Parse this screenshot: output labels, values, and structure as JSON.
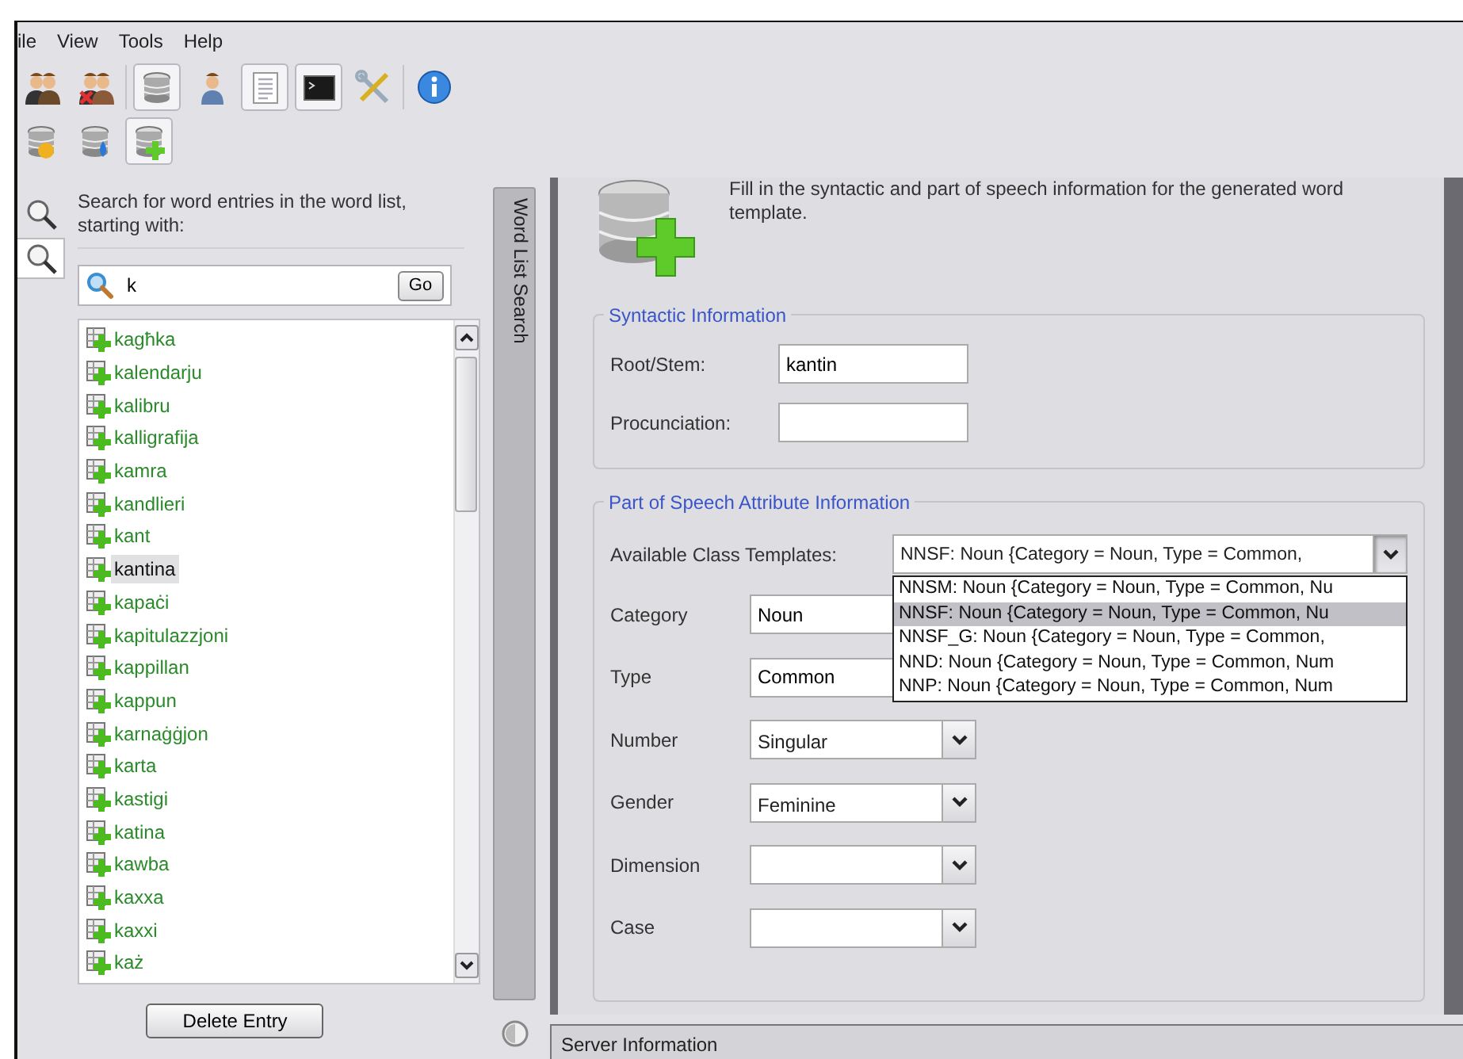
{
  "menu": [
    {
      "label": "ile"
    },
    {
      "label": "View"
    },
    {
      "label": "Tools"
    },
    {
      "label": "Help"
    }
  ],
  "toolbar_rows": [
    [
      {
        "kind": "people",
        "selected": false
      },
      {
        "kind": "people-remove",
        "selected": false
      },
      {
        "kind": "sep"
      },
      {
        "kind": "database",
        "selected": true
      },
      {
        "kind": "person",
        "selected": false
      },
      {
        "kind": "document",
        "selected": true
      },
      {
        "kind": "terminal",
        "selected": true
      },
      {
        "kind": "tools",
        "selected": false
      },
      {
        "kind": "sep"
      },
      {
        "kind": "info",
        "selected": false
      }
    ],
    [
      {
        "kind": "database-question",
        "selected": false
      },
      {
        "kind": "database-drop",
        "selected": false
      },
      {
        "kind": "database-add",
        "selected": true
      }
    ]
  ],
  "side_buttons": [
    {
      "selected": false
    },
    {
      "selected": true
    }
  ],
  "search_panel": {
    "description": "Search for word entries in the word list, starting with:",
    "query": "k",
    "go_button": "Go",
    "delete_button": "Delete Entry"
  },
  "word_list": [
    {
      "word": "kagħka",
      "selected": false
    },
    {
      "word": "kalendarju",
      "selected": false
    },
    {
      "word": "kalibru",
      "selected": false
    },
    {
      "word": "kalligrafija",
      "selected": false
    },
    {
      "word": "kamra",
      "selected": false
    },
    {
      "word": "kandlieri",
      "selected": false
    },
    {
      "word": "kant",
      "selected": false
    },
    {
      "word": "kantina",
      "selected": true
    },
    {
      "word": "kapaċi",
      "selected": false
    },
    {
      "word": "kapitulazzjoni",
      "selected": false
    },
    {
      "word": "kappillan",
      "selected": false
    },
    {
      "word": "kappun",
      "selected": false
    },
    {
      "word": "karnaġġjon",
      "selected": false
    },
    {
      "word": "karta",
      "selected": false
    },
    {
      "word": "kastigi",
      "selected": false
    },
    {
      "word": "katina",
      "selected": false
    },
    {
      "word": "kawba",
      "selected": false
    },
    {
      "word": "kaxxa",
      "selected": false
    },
    {
      "word": "kaxxi",
      "selected": false
    },
    {
      "word": "każ",
      "selected": false
    }
  ],
  "side_tab": "Word List Search",
  "intro": "Fill in the syntactic and part of speech information for the generated word template.",
  "syntactic": {
    "legend": "Syntactic Information",
    "fields": [
      {
        "label": "Root/Stem:",
        "value": "kantin"
      },
      {
        "label": "Procunciation:"
      }
    ]
  },
  "pos": {
    "legend": "Part of Speech Attribute Information",
    "templates": {
      "label": "Available Class Templates:",
      "value": "NNSF: Noun {Category = Noun, Type = Common,",
      "expanded": true,
      "options": [
        {
          "text": "NNSM: Noun {Category = Noun, Type = Common, Nu",
          "selected": false
        },
        {
          "text": "NNSF: Noun {Category = Noun, Type = Common, Nu",
          "selected": true
        },
        {
          "text": "NNSF_G: Noun {Category = Noun, Type = Common,",
          "selected": false
        },
        {
          "text": "NND: Noun {Category = Noun, Type = Common, Num",
          "selected": false
        },
        {
          "text": "NNP: Noun {Category = Noun, Type = Common, Num",
          "selected": false
        }
      ]
    },
    "fields": [
      {
        "kind": "text",
        "label": "Category",
        "value": "Noun"
      },
      {
        "kind": "text",
        "label": "Type",
        "value": "Common"
      },
      {
        "kind": "combo",
        "label": "Number",
        "value": "Singular"
      },
      {
        "kind": "combo",
        "label": "Gender",
        "value": "Feminine"
      },
      {
        "kind": "combo",
        "label": "Dimension"
      },
      {
        "kind": "combo",
        "label": "Case"
      }
    ]
  },
  "status_panel": "Server Information"
}
